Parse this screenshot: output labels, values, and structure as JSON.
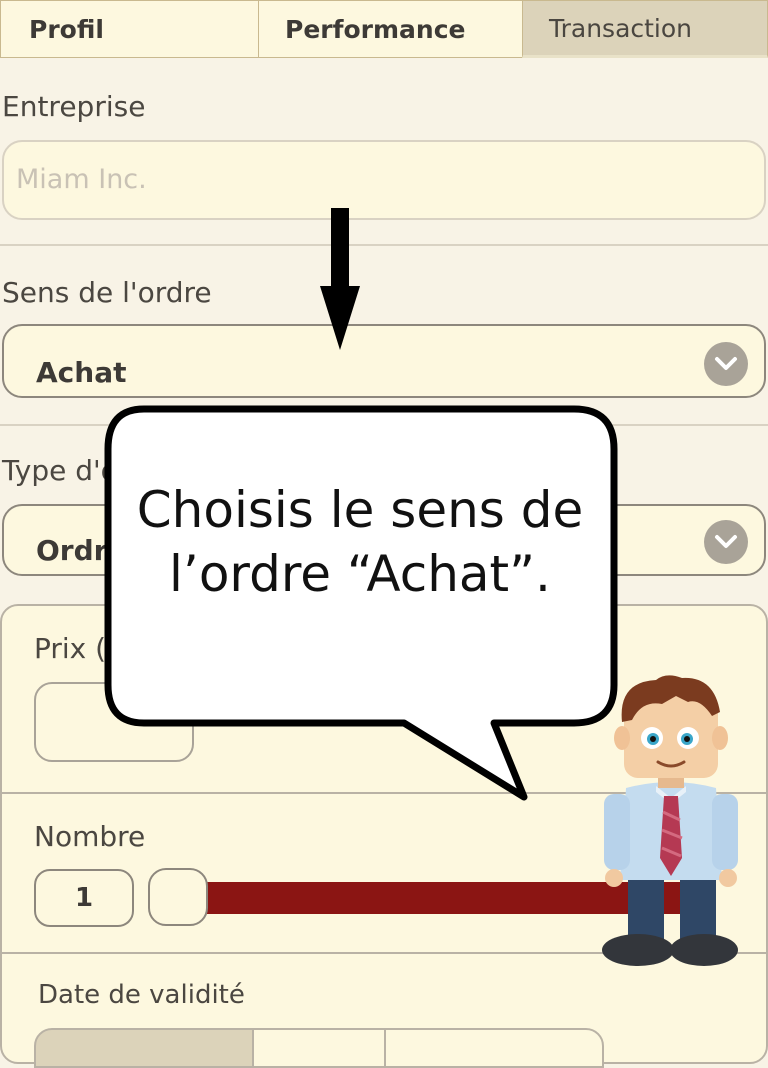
{
  "tabs": [
    {
      "label": "Profil"
    },
    {
      "label": "Performance"
    },
    {
      "label": "Transaction"
    }
  ],
  "entreprise": {
    "label": "Entreprise",
    "placeholder": "Miam Inc."
  },
  "sens": {
    "label": "Sens de l'ordre",
    "value": "Achat"
  },
  "type_ordre": {
    "label": "Type d'o",
    "value": "Ordre"
  },
  "prix": {
    "label": "Prix (€"
  },
  "nombre": {
    "label": "Nombre",
    "value": "1",
    "slider_fraction": 0.0
  },
  "validite": {
    "label": "Date de validité"
  },
  "tutorial": {
    "message_line1": "Choisis le sens de",
    "message_line2": "l’ordre “Achat”."
  },
  "colors": {
    "slider_fill": "#8b1513",
    "accent": "#fdf8df",
    "chevron_bg": "#a9a398"
  },
  "icons": {
    "select_chevron": "chevron-down-icon",
    "arrow": "arrow-down-icon"
  }
}
